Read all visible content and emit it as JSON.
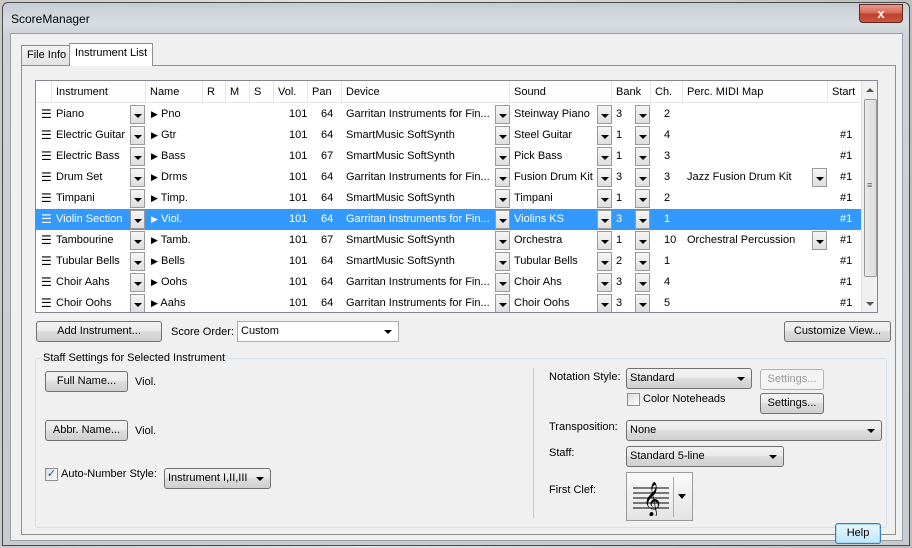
{
  "window": {
    "title": "ScoreManager",
    "close_label": "x"
  },
  "tabs": [
    {
      "label": "File Info",
      "active": false
    },
    {
      "label": "Instrument List",
      "active": true
    }
  ],
  "grid": {
    "columns": [
      "Instrument",
      "Name",
      "R",
      "M",
      "S",
      "Vol.",
      "Pan",
      "Device",
      "Sound",
      "Bank",
      "Ch.",
      "Perc. MIDI Map",
      "Start"
    ],
    "selected_row_index": 5,
    "rows": [
      {
        "instrument": "Piano",
        "name": "Pno",
        "vol": "101",
        "pan": "64",
        "device": "Garritan Instruments for Fin...",
        "sound": "Steinway Piano",
        "bank": "3",
        "ch": "2",
        "perc_map": "",
        "start": "",
        "remove": "×"
      },
      {
        "instrument": "Electric Guitar",
        "name": "Gtr",
        "vol": "101",
        "pan": "64",
        "device": "SmartMusic SoftSynth",
        "sound": "Steel Guitar",
        "bank": "1",
        "ch": "4",
        "perc_map": "",
        "start": "#1",
        "remove": "×"
      },
      {
        "instrument": "Electric Bass",
        "name": "Bass",
        "vol": "101",
        "pan": "67",
        "device": "SmartMusic SoftSynth",
        "sound": "Pick Bass",
        "bank": "1",
        "ch": "3",
        "perc_map": "",
        "start": "#1",
        "remove": "×"
      },
      {
        "instrument": "Drum Set",
        "name": "Drms",
        "vol": "101",
        "pan": "64",
        "device": "Garritan Instruments for Fin...",
        "sound": "Fusion Drum Kit",
        "bank": "3",
        "ch": "3",
        "perc_map": "Jazz Fusion Drum Kit",
        "start": "#1",
        "remove": "×"
      },
      {
        "instrument": "Timpani",
        "name": "Timp.",
        "vol": "101",
        "pan": "64",
        "device": "SmartMusic SoftSynth",
        "sound": "Timpani",
        "bank": "1",
        "ch": "2",
        "perc_map": "",
        "start": "#1",
        "remove": "×"
      },
      {
        "instrument": "Violin Section",
        "name": "Viol.",
        "vol": "101",
        "pan": "64",
        "device": "Garritan Instruments for Fin...",
        "sound": "Violins KS",
        "bank": "3",
        "ch": "1",
        "perc_map": "",
        "start": "#1",
        "remove": "×"
      },
      {
        "instrument": "Tambourine",
        "name": "Tamb.",
        "vol": "101",
        "pan": "67",
        "device": "SmartMusic SoftSynth",
        "sound": "Orchestra",
        "bank": "1",
        "ch": "10",
        "perc_map": "Orchestral Percussion",
        "start": "#1",
        "remove": "×"
      },
      {
        "instrument": "Tubular Bells",
        "name": "Bells",
        "vol": "101",
        "pan": "64",
        "device": "SmartMusic SoftSynth",
        "sound": "Tubular Bells",
        "bank": "2",
        "ch": "1",
        "perc_map": "",
        "start": "#1",
        "remove": "×"
      },
      {
        "instrument": "Choir Aahs",
        "name": "Oohs",
        "vol": "101",
        "pan": "64",
        "device": "Garritan Instruments for Fin...",
        "sound": "Choir Ahs",
        "bank": "3",
        "ch": "4",
        "perc_map": "",
        "start": "#1",
        "remove": "×"
      },
      {
        "instrument": "Choir Oohs",
        "name": "Aahs",
        "vol": "101",
        "pan": "64",
        "device": "Garritan Instruments for Fin...",
        "sound": "Choir Oohs",
        "bank": "3",
        "ch": "5",
        "perc_map": "",
        "start": "#1",
        "remove": "×"
      }
    ]
  },
  "toolbar": {
    "add_instrument_label": "Add Instrument...",
    "score_order_label": "Score Order:",
    "score_order_value": "Custom",
    "customize_view_label": "Customize View..."
  },
  "staff_settings": {
    "group_title": "Staff Settings for Selected Instrument",
    "full_name_button": "Full Name...",
    "full_name_value": "Viol.",
    "abbr_name_button": "Abbr. Name...",
    "abbr_name_value": "Viol.",
    "auto_number_label": "Auto-Number Style:",
    "auto_number_checked": true,
    "auto_number_value": "Instrument I,II,III",
    "notation_style_label": "Notation Style:",
    "notation_style_value": "Standard",
    "notation_settings_button": "Settings...",
    "color_noteheads_label": "Color Noteheads",
    "color_noteheads_checked": false,
    "color_settings_button": "Settings...",
    "transposition_label": "Transposition:",
    "transposition_value": "None",
    "staff_label": "Staff:",
    "staff_value": "Standard 5-line",
    "first_clef_label": "First Clef:",
    "first_clef_value": "treble-clef",
    "help_button": "Help"
  },
  "colors": {
    "selection": "#3399ff",
    "close_button": "#c9503b"
  }
}
